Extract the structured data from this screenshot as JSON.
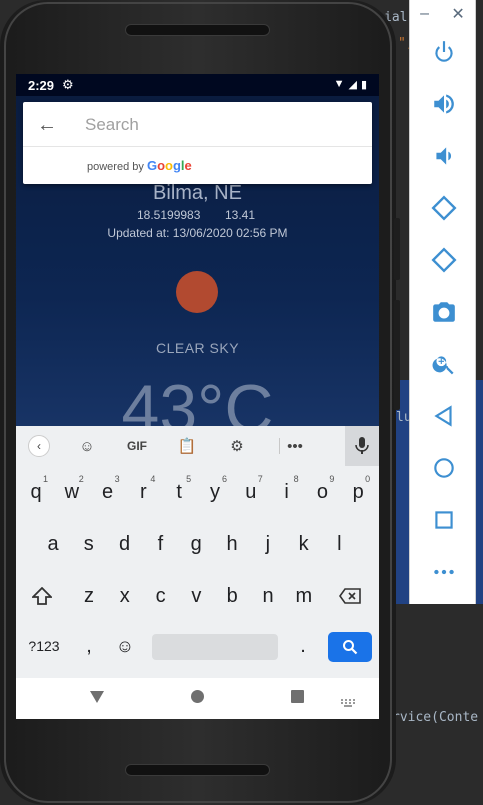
{
  "ide": {
    "line1": "ial",
    "line2": "\",",
    "line3": "lu",
    "line4": "rvice(Conte"
  },
  "emulator": {
    "top_controls": [
      "–",
      "✕"
    ],
    "buttons": [
      "power-icon",
      "volume-up-icon",
      "volume-down-icon",
      "rotate-left-icon",
      "rotate-right-icon",
      "camera-icon",
      "zoom-icon",
      "back-icon",
      "home-icon",
      "overview-icon",
      "more-icon"
    ]
  },
  "status_bar": {
    "time": "2:29"
  },
  "search": {
    "placeholder": "Search",
    "powered_by": "powered by"
  },
  "weather": {
    "city": "Bilma, NE",
    "latitude": "18.5199983",
    "longitude": "13.41",
    "updated": "Updated at: 13/06/2020 02:56 PM",
    "condition": "CLEAR SKY",
    "temperature": "43°C"
  },
  "keyboard": {
    "toolbar": {
      "gif": "GIF"
    },
    "row1": [
      "q",
      "w",
      "e",
      "r",
      "t",
      "y",
      "u",
      "i",
      "o",
      "p"
    ],
    "row1_hints": [
      "1",
      "2",
      "3",
      "4",
      "5",
      "6",
      "7",
      "8",
      "9",
      "0"
    ],
    "row2": [
      "a",
      "s",
      "d",
      "f",
      "g",
      "h",
      "j",
      "k",
      "l"
    ],
    "row3": [
      "z",
      "x",
      "c",
      "v",
      "b",
      "n",
      "m"
    ],
    "row4": {
      "numbers": "?123",
      "comma": ",",
      "period": "."
    }
  },
  "colors": {
    "accent": "#1a73e8",
    "sun": "#b24a30"
  }
}
